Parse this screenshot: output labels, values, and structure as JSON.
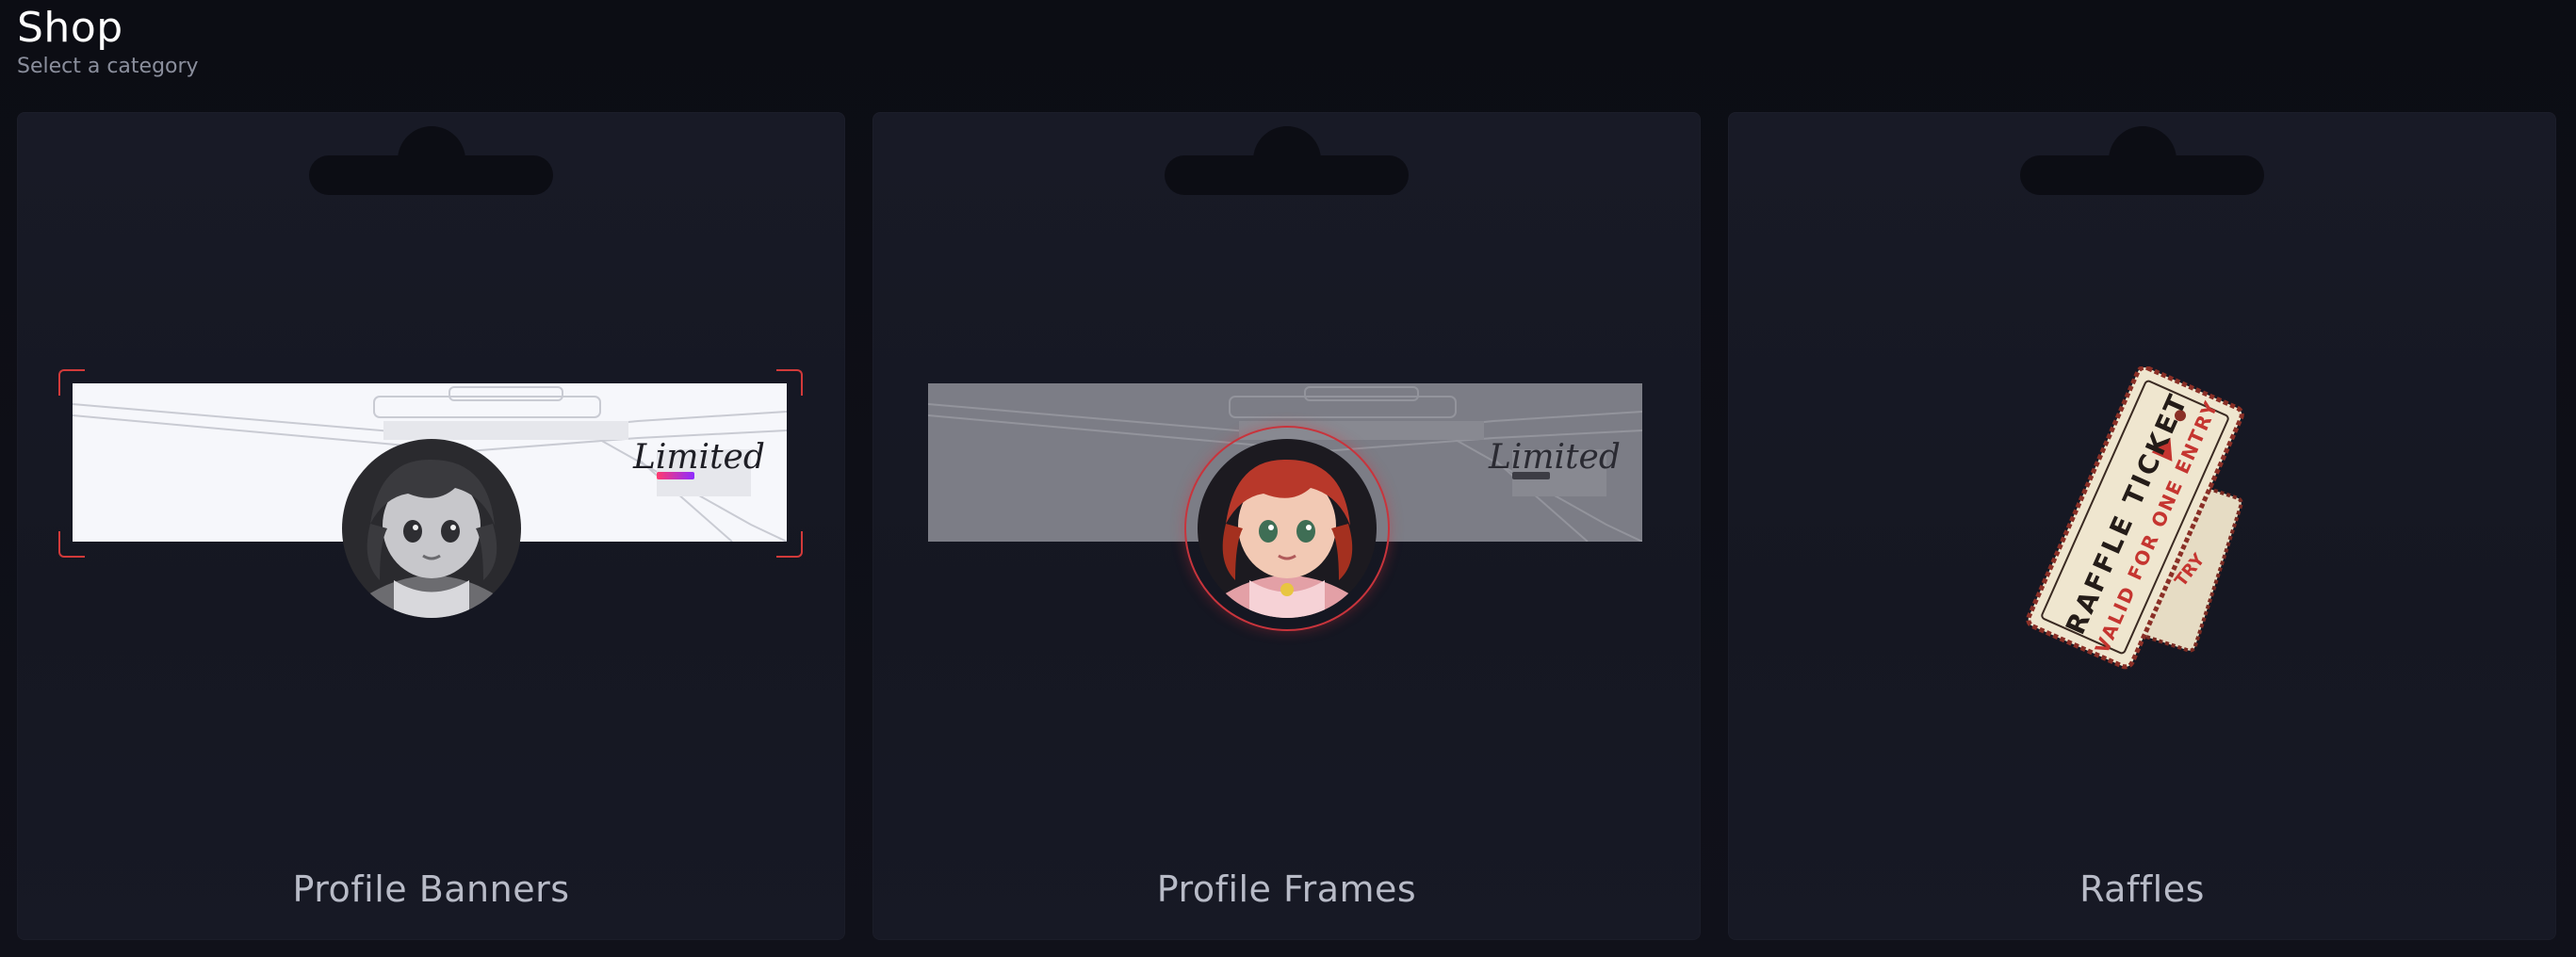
{
  "header": {
    "title": "Shop",
    "subtitle": "Select a category"
  },
  "cards": [
    {
      "label": "Profile Banners",
      "banner_signature": "Limited"
    },
    {
      "label": "Profile Frames",
      "banner_signature": "Limited"
    },
    {
      "label": "Raffles",
      "ticket_title": "RAFFLE TICKET",
      "ticket_subtitle": "VALID FOR ONE ENTRY",
      "ticket_back_text": "ET",
      "ticket_back_sub": "TRY"
    }
  ],
  "colors": {
    "background": "#0d0e16",
    "card": "#181a26",
    "accent_red": "#d23a3a",
    "label": "#b8bbc7"
  },
  "icons": [
    "avatar-girl-grayscale",
    "avatar-girl-color",
    "raffle-ticket"
  ]
}
